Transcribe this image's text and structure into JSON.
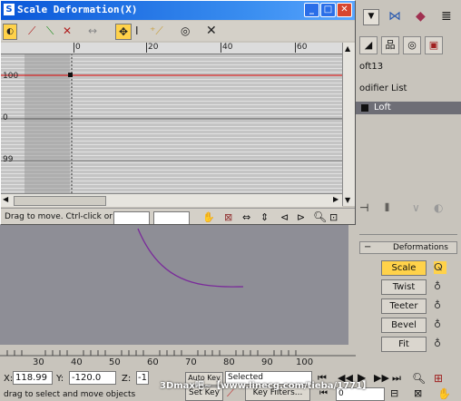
{
  "window": {
    "title": "Scale Deformation(X)",
    "status": "Drag to move. Ctrl-click or d"
  },
  "ruler": {
    "ticks": [
      "0",
      "20",
      "40",
      "60"
    ]
  },
  "graph": {
    "y_labels": [
      "100",
      "0",
      "99"
    ]
  },
  "modifier_panel": {
    "object_name": "oft13",
    "modifier_list_label": "odifier List",
    "stack_item": "Loft",
    "rollout_title": "Deformations",
    "buttons": [
      "Scale",
      "Twist",
      "Teeter",
      "Bevel",
      "Fit"
    ]
  },
  "timeline": {
    "ticks": [
      "30",
      "40",
      "50",
      "60",
      "70",
      "80",
      "90",
      "100"
    ]
  },
  "coords": {
    "x_label": "X:",
    "x_value": "118.99",
    "y_label": "Y:",
    "y_value": "-120.0",
    "z_label": "Z:",
    "z_value": "-1"
  },
  "prompt": "drag to select and move objects",
  "anim": {
    "auto_key": "Auto Key",
    "set_key": "Set Key",
    "selected": "Selected",
    "key_filters": "Key Filters...",
    "frame": "0"
  },
  "watermark": "3Dmax吧~【www.linecg.com/tieba/1771】",
  "colors": {
    "title_bar": "#0a57d8",
    "active_button": "#ffd24a",
    "curve": "#d02020",
    "spline": "#7a2a9a",
    "selected_stack": "#6e6e76"
  }
}
